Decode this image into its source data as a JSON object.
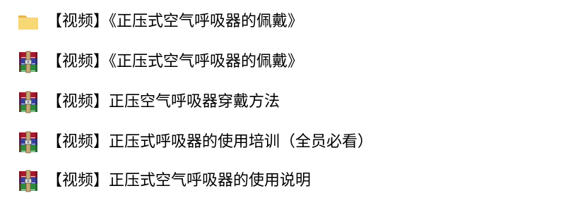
{
  "items": [
    {
      "type": "folder",
      "icon": "folder-icon",
      "name": "【视频】《正压式空气呼吸器的佩戴》"
    },
    {
      "type": "archive",
      "icon": "rar-archive-icon",
      "name": "【视频】《正压式空气呼吸器的佩戴》"
    },
    {
      "type": "archive",
      "icon": "rar-archive-icon",
      "name": "【视频】正压空气呼吸器穿戴方法"
    },
    {
      "type": "archive",
      "icon": "rar-archive-icon",
      "name": "【视频】正压式呼吸器的使用培训（全员必看）"
    },
    {
      "type": "archive",
      "icon": "rar-archive-icon",
      "name": "【视频】正压式空气呼吸器的使用说明"
    }
  ],
  "colors": {
    "folder_body": "#F8D775",
    "folder_tab": "#E8B84A",
    "archive_red": "#A8182E",
    "archive_blue": "#3A3F9E",
    "archive_green": "#2E8B3E",
    "archive_strap": "#C8A878",
    "text": "#000000"
  }
}
